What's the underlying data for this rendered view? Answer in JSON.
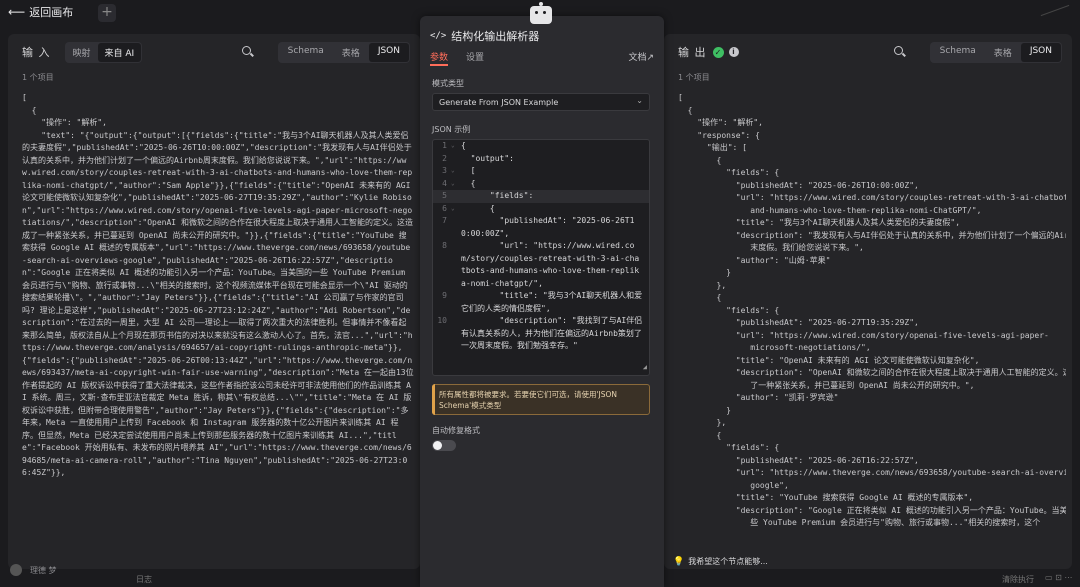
{
  "topbar": {
    "back_label": "返回画布",
    "back_icon": "arrow-left-icon",
    "add_icon": "plus-icon"
  },
  "input_pane": {
    "title": "输 入",
    "toggle": [
      "映射",
      "来自 AI"
    ],
    "toggle_active": 1,
    "views": [
      "Schema",
      "表格",
      "JSON"
    ],
    "views_active": 2,
    "count": "1 个项目",
    "json_text": "[\n  {\n    \"操作\": \"解析\",\n    \"text\": \"{\"output\":{\"output\":[{\"fields\":{\"title\":\"我与3个AI聊天机器人及其人类爱侣的夫妻度假\",\"publishedAt\":\"2025-06-26T10:00:00Z\",\"description\":\"我发现有人与AI伴侣处于认真的关系中，并为他们计划了一个偏远的Airbnb周末度假。我们给您说说下来。\",\"url\":\"https://www.wired.com/story/couples-retreat-with-3-ai-chatbots-and-humans-who-love-them-replika-nomi-chatgpt/\",\"author\":\"Sam Apple\"}},{\"fields\":{\"title\":\"OpenAI 未来有的 AGI 论文可能使微软认知复杂化\",\"publishedAt\":\"2025-06-27T19:35:29Z\",\"author\":\"Kylie Robison\",\"url\":\"https://www.wired.com/story/openai-five-levels-agi-paper-microsoft-negotiations/\",\"description\":\"OpenAI 和微软之间的合作在很大程度上取决于通用人工智能的定义。这造成了一种紧张关系，并已蔓延到 OpenAI 尚未公开的研究中。\"}},{\"fields\":{\"title\":\"YouTube 搜索获得 Google AI 概述的专属版本\",\"url\":\"https://www.theverge.com/news/693658/youtube-search-ai-overviews-google\",\"publishedAt\":\"2025-06-26T16:22:57Z\",\"description\":\"Google 正在将类似 AI 概述的功能引入另一个产品：YouTube。当美国的一些 YouTube Premium 会员进行与\\\"购物、旅行或事物...\\\"相关的搜索时，这个视频流媒体平台现在可能会显示一个\\\"AI 驱动的搜索结果轮播\\\"。\",\"author\":\"Jay Peters\"}},{\"fields\":{\"title\":\"AI 公司赢了与作家的官司吗? 理论上是这样\",\"publishedAt\":\"2025-06-27T23:12:24Z\",\"author\":\"Adi Robertson\",\"description\":\"在过去的一周里，大型 AI 公司——理论上——取得了两次重大的法律胜利。但事情并不像看起来那么简单，版权法自从上个月现在那页书信的对决以来就没有这么激动人心了。首先，法官...\",\"url\":\"https://www.theverge.com/analysis/694657/ai-copyright-rulings-anthropic-meta\"}},{\"fields\":{\"publishedAt\":\"2025-06-26T00:13:44Z\",\"url\":\"https://www.theverge.com/news/693437/meta-ai-copyright-win-fair-use-warning\",\"description\":\"Meta 在一起由13位作者提起的 AI 版权诉讼中获得了重大法律裁决，这些作者指控该公司未经许可非法使用他们的作品训练其 AI 系统。周三，文斯·查布里亚法官裁定 Meta 胜诉，称其\\\"有权总结...\\\"\",\"title\":\"Meta 在 AI 版权诉讼中获胜，但附带合理使用警告\",\"author\":\"Jay Peters\"}},{\"fields\":{\"description\":\"多年来，Meta 一直使用用户上传到 Facebook 和 Instagram 服务器的数十亿公开图片来训练其 AI 程序。但显然，Meta 已经决定尝试使用用户尚未上传到那些服务器的数十亿图片来训练其 AI...\",\"title\":\"Facebook 开始用私有、未发布的照片喂养其 AI\",\"url\":\"https://www.theverge.com/news/694685/meta-ai-camera-roll\",\"author\":\"Tina Nguyen\",\"publishedAt\":\"2025-06-27T23:06:45Z\"}},"
  },
  "dialog": {
    "title": "结构化输出解析器",
    "title_icon": "code-icon",
    "tabs": [
      "参数",
      "设置"
    ],
    "tab_active": 0,
    "docs_label": "文档",
    "docs_icon": "external-link-icon",
    "schema_type_label": "模式类型",
    "schema_type_value": "Generate From JSON Example",
    "json_example_label": "JSON 示例",
    "editor_lines": [
      {
        "n": "1",
        "fold": "⌄",
        "text": "{"
      },
      {
        "n": "2",
        "fold": "",
        "text": "  \"output\":"
      },
      {
        "n": "3",
        "fold": "⌄",
        "text": "  ["
      },
      {
        "n": "4",
        "fold": "⌄",
        "text": "  {"
      },
      {
        "n": "5",
        "fold": "",
        "text": "      \"fields\":"
      },
      {
        "n": "6",
        "fold": "⌄",
        "text": "      {"
      },
      {
        "n": "7",
        "fold": "",
        "text": "        \"publishedAt\": \"2025-06-26T10:00:00Z\","
      },
      {
        "n": "8",
        "fold": "",
        "text": "        \"url\": \"https://www.wired.com/story/couples-retreat-with-3-ai-chatbots-and-humans-who-love-them-replika-nomi-chatgpt/\","
      },
      {
        "n": "9",
        "fold": "",
        "text": "        \"title\": \"我与3个AI聊天机器人和爱它们的人类的情侣度假\","
      },
      {
        "n": "10",
        "fold": "",
        "text": "        \"description\": \"我找到了与AI伴侣有认真关系的人，并为他们在偏远的Airbnb策划了一次周末度假。我们勉强幸存。\""
      }
    ],
    "notice": "所有属性都将被要求。若要使它们可选，请使用'JSON Schema'模式类型",
    "autofix_label": "自动修复格式",
    "autofix_on": false
  },
  "output_pane": {
    "title": "输 出",
    "views": [
      "Schema",
      "表格",
      "JSON"
    ],
    "views_active": 2,
    "count": "1 个项目",
    "json_text": "[\n  {\n    \"操作\": \"解析\",\n    \"response\": {\n      \"输出\": [\n        {\n          \"fields\": {\n            \"publishedAt\": \"2025-06-26T10:00:00Z\",\n            \"url\": \"https://www.wired.com/story/couples-retreat-with-3-ai-chatbots-\n               and-humans-who-love-them-replika-nomi-ChatGPT/\",\n            \"title\": \"我与3个AI聊天机器人及其人类爱侣的夫妻度假\",\n            \"description\": \"我发现有人与AI伴侣处于认真的关系中，并为他们计划了一个偏远的Airbnb周\n               末度假。我们给您说说下来。\",\n            \"author\": \"山姆·苹果\"\n          }\n        },\n        {\n          \"fields\": {\n            \"publishedAt\": \"2025-06-27T19:35:29Z\",\n            \"url\": \"https://www.wired.com/story/openai-five-levels-agi-paper-\n               microsoft-negotiations/\",\n            \"title\": \"OpenAI 未来有的 AGI 论文可能使微软认知复杂化\",\n            \"description\": \"OpenAI 和微软之间的合作在很大程度上取决于通用人工智能的定义。这造成\n               了一种紧张关系，并已蔓延到 OpenAI 尚未公开的研究中。\",\n            \"author\": \"凯莉·罗宾逊\"\n          }\n        },\n        {\n          \"fields\": {\n            \"publishedAt\": \"2025-06-26T16:22:57Z\",\n            \"url\": \"https://www.theverge.com/news/693658/youtube-search-ai-overviews-\n               google\",\n            \"title\": \"YouTube 搜索获得 Google AI 概述的专属版本\",\n            \"description\": \"Google 正在将类似 AI 概述的功能引入另一个产品：YouTube。当美国的一\n               些 YouTube Premium 会员进行与\"购物、旅行或事物...\"相关的搜索时，这个"
  },
  "footer": {
    "user": "理德 梦",
    "log": "日志",
    "hint": "我希望这个节点能够...",
    "hint_icon": "lightbulb-icon",
    "right_label": "清除执行"
  },
  "colors": {
    "accent": "#ff6d5a",
    "success": "#3fbf63",
    "warning": "#e0a24a"
  }
}
